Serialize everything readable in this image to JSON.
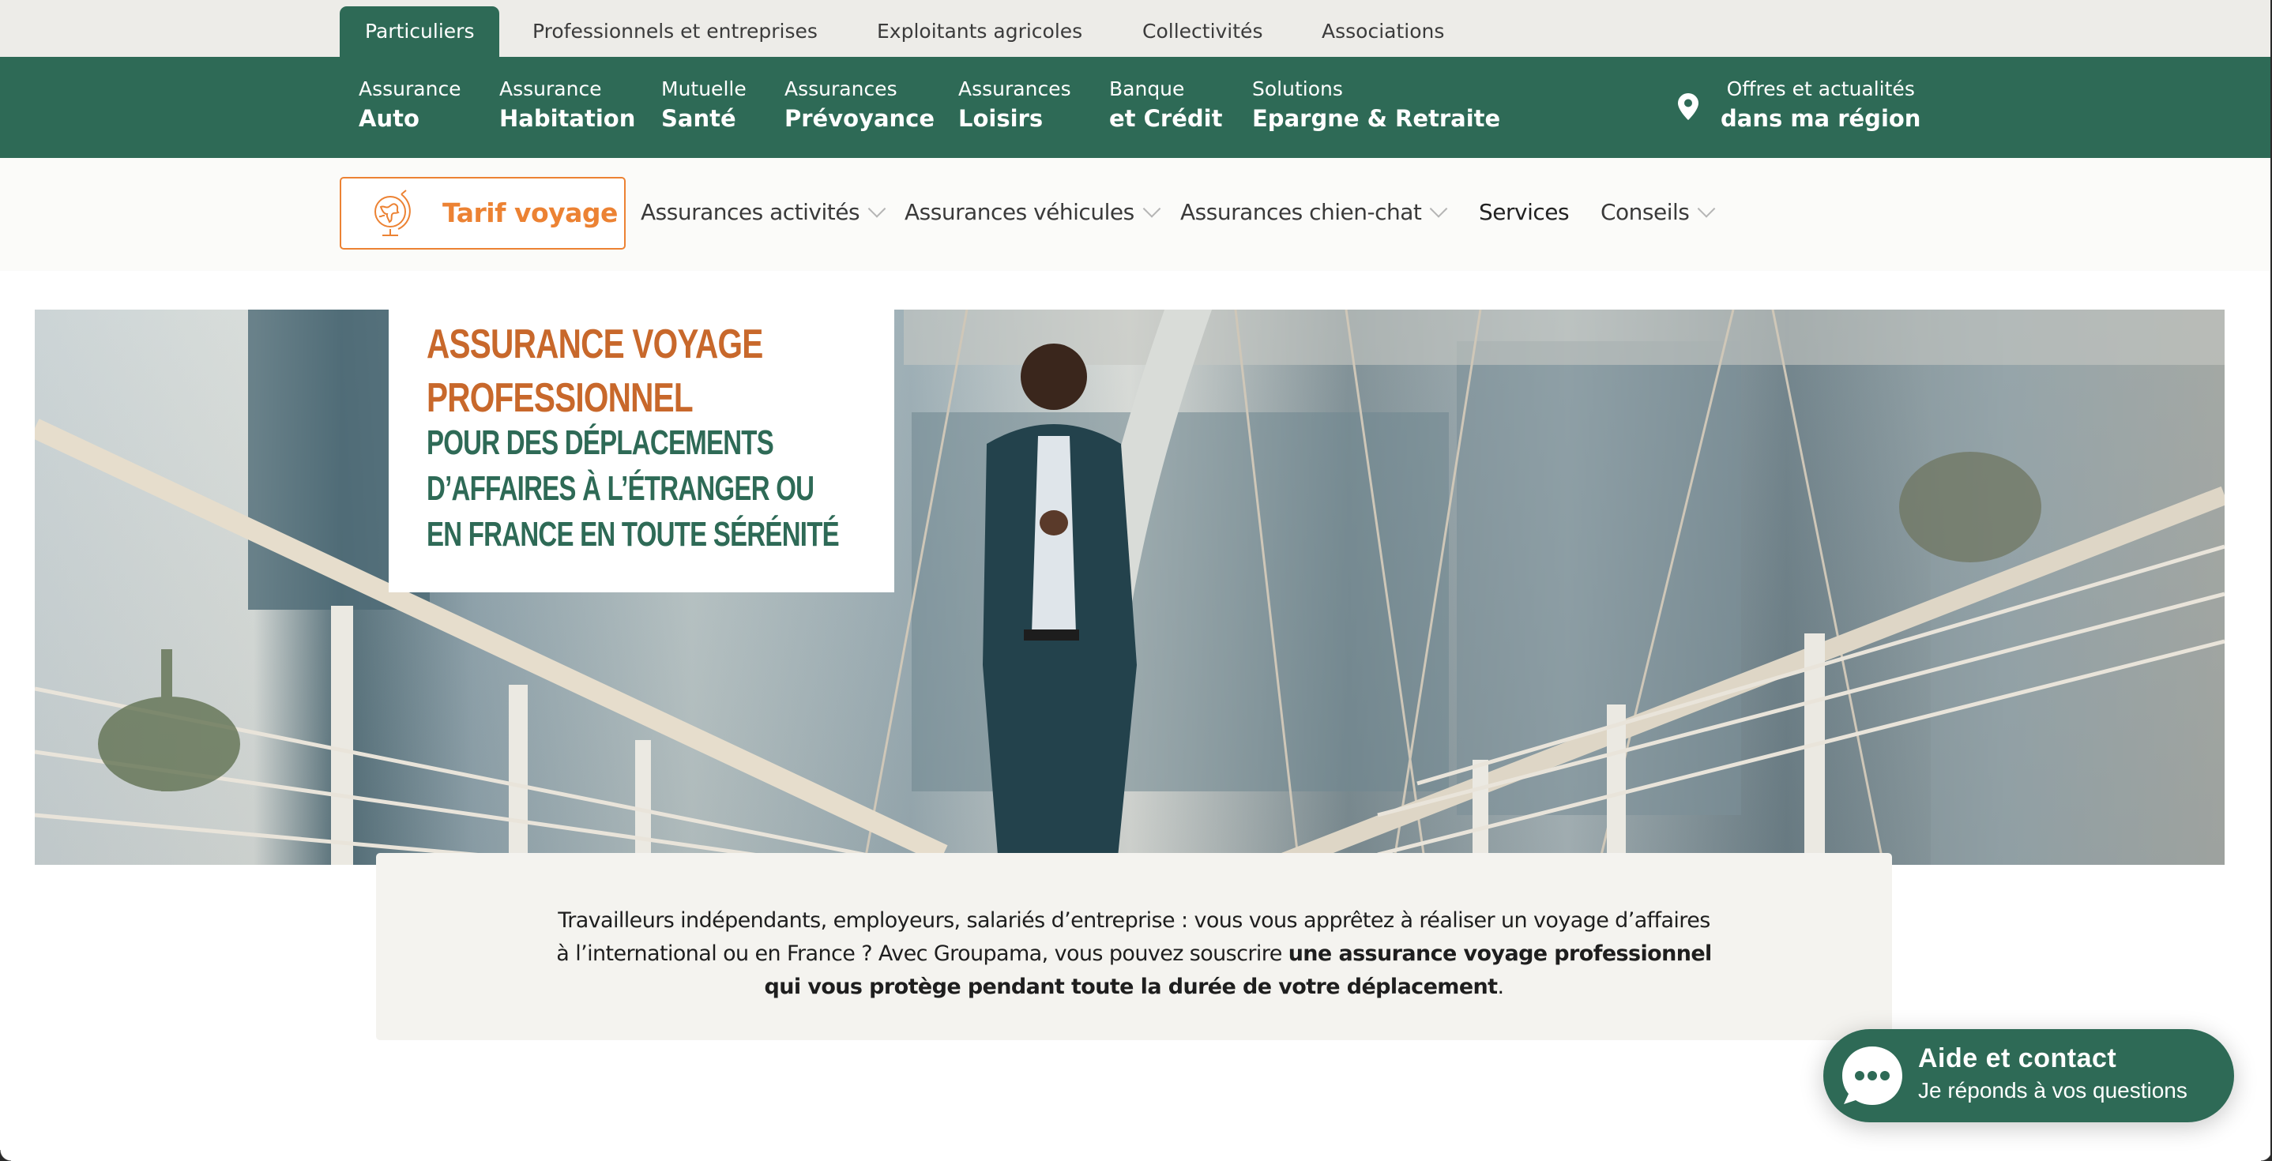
{
  "colors": {
    "brand_green": "#2e6a56",
    "accent_orange": "#ec8233",
    "title_orange": "#c8682b",
    "topbar_bg": "#edece8",
    "subnav_bg": "#fbfbf9",
    "intro_bg": "#f4f3ef"
  },
  "segments": [
    {
      "label": "Particuliers",
      "active": true
    },
    {
      "label": "Professionnels et entreprises",
      "active": false
    },
    {
      "label": "Exploitants agricoles",
      "active": false
    },
    {
      "label": "Collectivités",
      "active": false
    },
    {
      "label": "Associations",
      "active": false
    }
  ],
  "main_nav": [
    {
      "line1": "Assurance",
      "line2": "Auto"
    },
    {
      "line1": "Assurance",
      "line2": "Habitation"
    },
    {
      "line1": "Mutuelle",
      "line2": "Santé"
    },
    {
      "line1": "Assurances",
      "line2": "Prévoyance"
    },
    {
      "line1": "Assurances",
      "line2": "Loisirs"
    },
    {
      "line1": "Banque",
      "line2": "et Crédit"
    },
    {
      "line1": "Solutions",
      "line2": "Epargne & Retraite"
    }
  ],
  "region": {
    "icon": "map-pin-icon",
    "line1": "Offres et actualités",
    "line2": "dans ma région"
  },
  "sub_nav": {
    "cta": {
      "icon": "globe-icon",
      "label": "Tarif voyage"
    },
    "items": [
      {
        "label": "Assurances activités",
        "dropdown": true
      },
      {
        "label": "Assurances véhicules",
        "dropdown": true
      },
      {
        "label": "Assurances chien-chat",
        "dropdown": true
      },
      {
        "label": "Services",
        "dropdown": false
      },
      {
        "label": "Conseils",
        "dropdown": true
      }
    ]
  },
  "hero": {
    "title": "Assurance voyage professionnel",
    "subtitle": "Pour des déplacements d’affaires à l’étranger ou en France en toute sérénité",
    "image_alt": "Homme d'affaires souriant regardant son téléphone sur une passerelle"
  },
  "intro": {
    "text_plain": "Travailleurs indépendants, employeurs, salariés d’entreprise : vous vous apprêtez à réaliser un voyage d’affaires à l’international ou en France ? Avec Groupama, vous pouvez souscrire ",
    "text_bold": "une assurance voyage professionnel qui vous protège pendant toute la durée de votre déplacement",
    "text_end": "."
  },
  "chat": {
    "icon": "chat-bubble-icon",
    "title": "Aide et contact",
    "subtitle": "Je réponds à vos questions"
  }
}
